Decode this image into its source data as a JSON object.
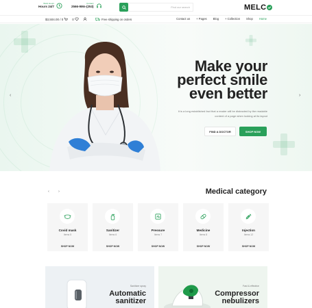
{
  "header": {
    "hours_caption": "Work Hours",
    "hours_value": "Hours 24/7",
    "contact_caption": "Contact",
    "contact_value": "2566-9Mn-(253)",
    "search_placeholder": "Find our search",
    "logo": "MELC"
  },
  "nav": {
    "price": "$3,504.00 / 0",
    "cart_count": "0",
    "wishlist_count": "0",
    "promo": "Free shipping on orders",
    "links": [
      "Contact us",
      "Pages",
      "Blog",
      "Collection",
      "Shop",
      "Home"
    ],
    "active_link": "Home"
  },
  "hero": {
    "title": "Make your perfect smile even better",
    "description": "It is a long established fact that a reader will be distracted by the readable content of a page when looking at its layout",
    "find_doctor": "FIND A DOCTOR",
    "shop_now": "SHOP NOW",
    "arrow_prev": "‹",
    "arrow_next": "›"
  },
  "category": {
    "title": "Medical category",
    "prev": "‹",
    "next": "›",
    "items": [
      {
        "name": "Covid mask",
        "count": "Items 5",
        "shop": "SHOP NOW",
        "icon": "mask-icon"
      },
      {
        "name": "Sanitizer",
        "count": "Items 6",
        "shop": "SHOP NOW",
        "icon": "sanitizer-icon"
      },
      {
        "name": "Pressure",
        "count": "Items 7",
        "shop": "SHOP NOW",
        "icon": "pressure-icon"
      },
      {
        "name": "Medicine",
        "count": "Items 8",
        "shop": "SHOP NOW",
        "icon": "pill-icon"
      },
      {
        "name": "Injection",
        "count": "Items 12",
        "shop": "SHOP NOW",
        "icon": "syringe-icon"
      }
    ]
  },
  "promos": [
    {
      "kicker": "Sanitizer spray",
      "line1": "Automatic",
      "line2": "sanitizer"
    },
    {
      "kicker": "Fast & effective",
      "line1": "Compressor",
      "line2": "nebulizers"
    }
  ],
  "colors": {
    "accent": "#2aa05a",
    "hero_bg": "#eef7f1",
    "card_bg": "#f6f6f6"
  }
}
